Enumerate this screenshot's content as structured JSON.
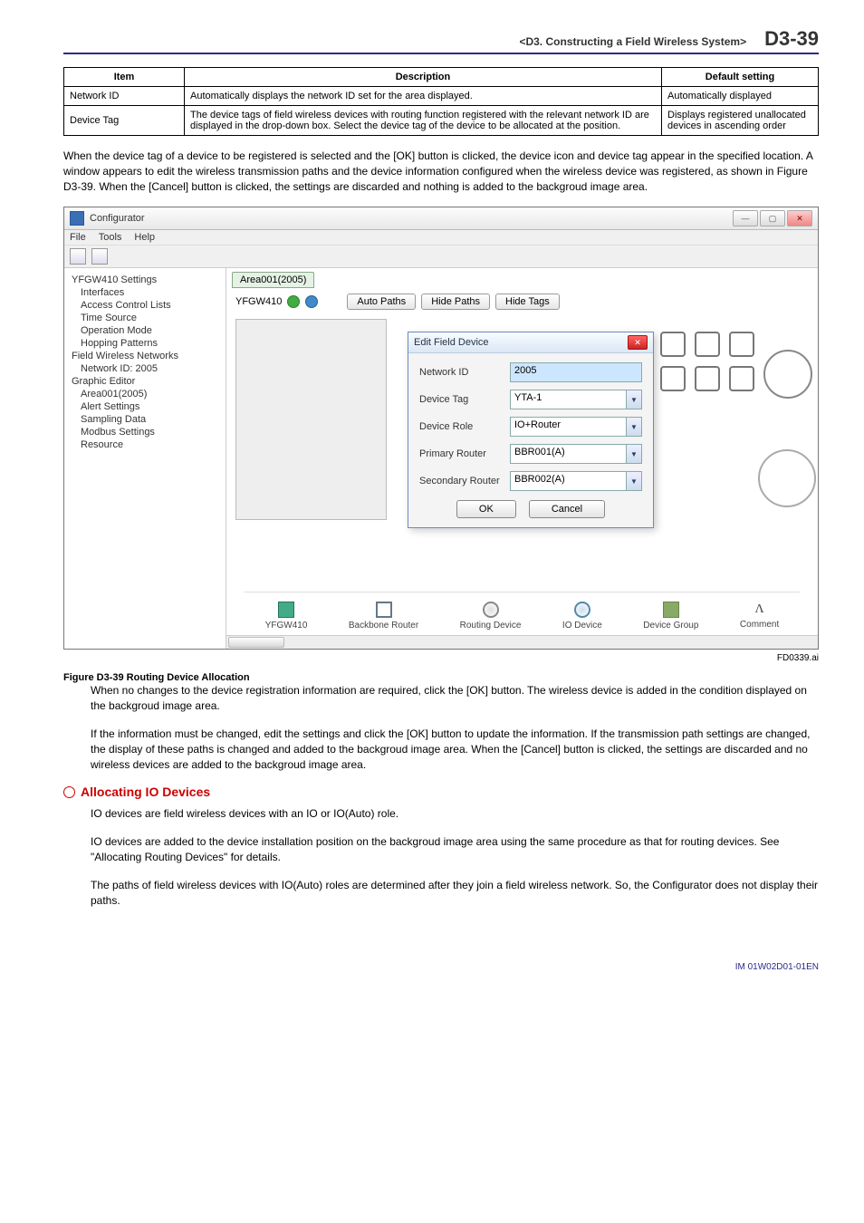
{
  "header": {
    "title": "<D3.  Constructing a Field Wireless System>",
    "page": "D3-39"
  },
  "table": {
    "cols": [
      "Item",
      "Description",
      "Default setting"
    ],
    "rows": [
      {
        "item": "Network ID",
        "desc": "Automatically displays the network ID set for the area displayed.",
        "def": "Automatically displayed"
      },
      {
        "item": "Device Tag",
        "desc": "The device tags of field wireless devices with routing function registered with the relevant network ID are displayed in the drop-down box. Select the device tag of the device to be allocated at the position.",
        "def": "Displays registered unallocated devices in ascending order"
      }
    ]
  },
  "para1": "When the device tag of a device to be registered is selected and the [OK] button is clicked, the device icon and device tag appear in the specified location. A window appears to edit the wireless transmission paths and the device information configured when the wireless device was registered, as shown in Figure D3-39. When the [Cancel] button is clicked, the settings are discarded and nothing is added to the backgroud image area.",
  "cfg": {
    "title": "Configurator",
    "menus": [
      "File",
      "Tools",
      "Help"
    ],
    "area_tab": "Area001(2005)",
    "gw": "YFGW410",
    "btns": {
      "auto": "Auto Paths",
      "hidep": "Hide Paths",
      "hidet": "Hide Tags"
    },
    "tree": [
      {
        "t": "YFGW410 Settings",
        "i": 0
      },
      {
        "t": "Interfaces",
        "i": 1
      },
      {
        "t": "Access Control Lists",
        "i": 1
      },
      {
        "t": "Time Source",
        "i": 1
      },
      {
        "t": "Operation Mode",
        "i": 1
      },
      {
        "t": "Hopping Patterns",
        "i": 1
      },
      {
        "t": "Field Wireless Networks",
        "i": 0
      },
      {
        "t": "Network ID: 2005",
        "i": 1
      },
      {
        "t": "Graphic Editor",
        "i": 0
      },
      {
        "t": "Area001(2005)",
        "i": 1
      },
      {
        "t": "Alert Settings",
        "i": 1
      },
      {
        "t": "Sampling Data",
        "i": 1
      },
      {
        "t": "Modbus Settings",
        "i": 1
      },
      {
        "t": "Resource",
        "i": 1
      }
    ],
    "modal": {
      "title": "Edit Field Device",
      "fields": {
        "netid": {
          "label": "Network ID",
          "value": "2005"
        },
        "devtag": {
          "label": "Device Tag",
          "value": "YTA-1"
        },
        "role": {
          "label": "Device Role",
          "value": "IO+Router"
        },
        "prim": {
          "label": "Primary Router",
          "value": "BBR001(A)"
        },
        "sec": {
          "label": "Secondary Router",
          "value": "BBR002(A)"
        }
      },
      "ok": "OK",
      "cancel": "Cancel"
    },
    "legend": {
      "gw": "YFGW410",
      "bbr": "Backbone Router",
      "rd": "Routing Device",
      "io": "IO Device",
      "dg": "Device Group",
      "cm": "Comment",
      "lambda": "Λ"
    }
  },
  "fig": {
    "id": "FD0339.ai",
    "caption": "Figure D3-39 Routing Device Allocation"
  },
  "para2": "When no changes to the device registration information are required, click the [OK] button. The wireless device is added in the condition displayed on the backgroud image area.",
  "para3": "If the information must be changed, edit the settings and click the [OK] button to update the information. If the transmission path settings are changed, the display of these paths is changed and added to the backgroud image area. When the [Cancel] button is clicked, the settings are discarded and no wireless devices are added to the backgroud image area.",
  "h_alloc": "Allocating IO Devices",
  "para4": "IO devices are field wireless devices with an IO or IO(Auto) role.",
  "para5": "IO devices are added to the device installation position on the backgroud image area using the same procedure as that for routing devices. See \"Allocating Routing Devices\" for details.",
  "para6": "The paths of field wireless devices with IO(Auto) roles are determined after they join a field wireless network. So, the Configurator does not display their paths.",
  "footer": "IM 01W02D01-01EN"
}
